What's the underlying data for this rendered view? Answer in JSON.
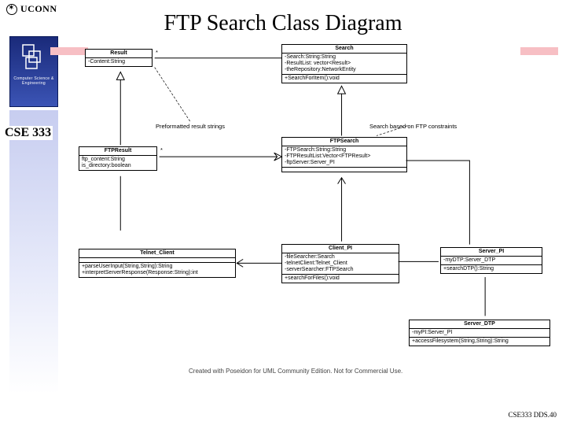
{
  "header": {
    "brand": "UCONN"
  },
  "title": "FTP Search Class Diagram",
  "sidebar": {
    "dept": "Computer Science & Engineering"
  },
  "course": "CSE 333",
  "footer": "CSE333 DDS.40",
  "watermark": "Created with Poseidon for UML Community Edition. Not for Commercial Use.",
  "notes": {
    "result_note": "Preformatted result strings",
    "search_note": "Search based on FTP constraints"
  },
  "classes": {
    "result": {
      "name": "Result",
      "attrs": [
        "-Content:String"
      ],
      "ops": []
    },
    "search": {
      "name": "Search",
      "attrs": [
        "-Search:String:String",
        "-ResultList: vector<Result>",
        "-theRepository:NetworkEntity"
      ],
      "ops": [
        "+SearchForItem():void"
      ]
    },
    "ftpresult": {
      "name": "FTPResult",
      "attrs": [
        "ftp_content:String",
        "is_directory:boolean"
      ],
      "ops": []
    },
    "ftpsearch": {
      "name": "FTPSearch",
      "attrs": [
        "-FTPSearch:String:String",
        "-FTPResultList:Vector<FTPResult>",
        "-ftpServer:Server_PI"
      ],
      "ops": []
    },
    "telnet": {
      "name": "Telnet_Client",
      "attrs": [],
      "ops": [
        "+parseUserInput(String,String):String",
        "+interpretServerResponse(Response:String):int"
      ]
    },
    "clientpi": {
      "name": "Client_PI",
      "attrs": [
        "-fileSearcher:Search",
        "-telnetClient:Telnet_Client",
        "-serverSearcher:FTPSearch"
      ],
      "ops": [
        "+searchForFiles():void"
      ]
    },
    "serverpi": {
      "name": "Server_PI",
      "attrs": [
        "-myDTP:Server_DTP"
      ],
      "ops": [
        "+searchDTP():String"
      ]
    },
    "serverdtp": {
      "name": "Server_DTP",
      "attrs": [
        "-myPI:Server_PI"
      ],
      "ops": [
        "+accessFilesystem(String,String):String"
      ]
    }
  },
  "multiplicity": {
    "result_star": "*",
    "ftpresult_star": "*"
  }
}
